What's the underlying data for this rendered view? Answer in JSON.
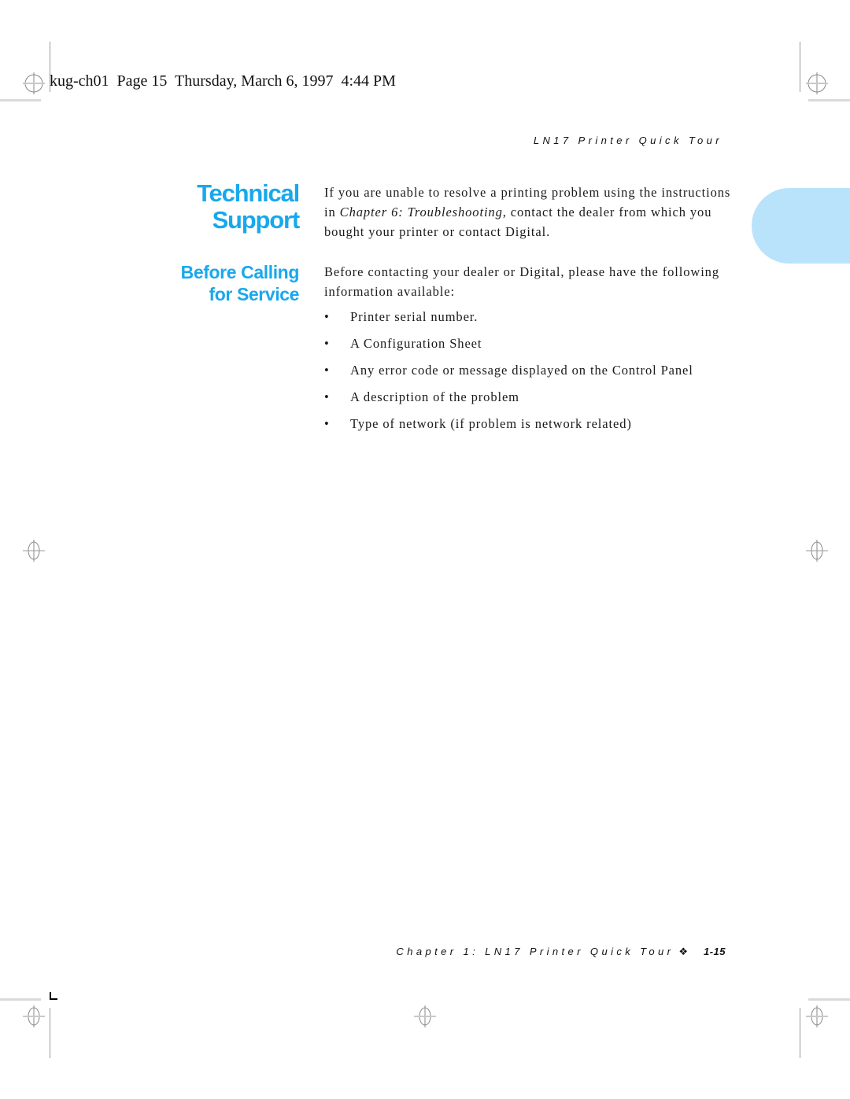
{
  "slug": "kug-ch01  Page 15  Thursday, March 6, 1997  4:44 PM",
  "running_head": "LN17 Printer Quick Tour",
  "headings": {
    "technical_support": [
      "Technical",
      "Support"
    ],
    "before_calling": [
      "Before Calling",
      "for Service"
    ]
  },
  "colors": {
    "heading_blue": "#18a8ec",
    "thumb_tab": "#b9e3fa"
  },
  "paragraph1": {
    "before": "If you are unable to resolve a printing problem using the instructions in ",
    "emphasis": "Chapter 6: Troubleshooting",
    "after": ", contact the dealer from which you bought your printer or contact Digital."
  },
  "paragraph2": "Before contacting your dealer or Digital, please have the following information available:",
  "bullet_glyph": "•",
  "items": [
    "Printer serial number.",
    "A Configuration Sheet",
    "Any error code or message displayed on the Control Panel",
    "A description of the problem",
    "Type of network (if problem is network related)"
  ],
  "footer": {
    "chapter": "Chapter 1: LN17 Printer Quick Tour",
    "ornament": "❖",
    "page_number": "1-15"
  },
  "icons": {
    "registration_mark": "registration-crosshair-icon",
    "crop_corner": "crop-corner-icon"
  }
}
